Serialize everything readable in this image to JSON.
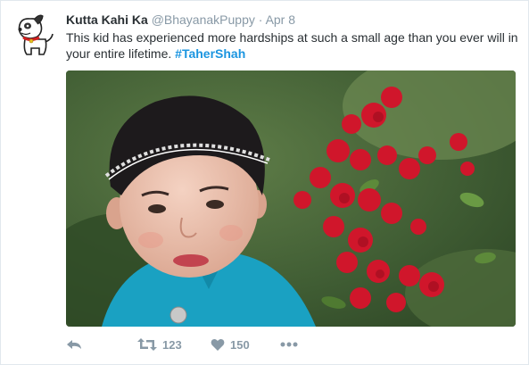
{
  "tweet": {
    "display_name": "Kutta Kahi Ka",
    "handle": "@BhayanakPuppy",
    "separator": "·",
    "timestamp": "Apr 8",
    "text": "This kid has experienced more hardships at such a small age than you ever will in your entire lifetime. ",
    "hashtag": "#TaherShah",
    "avatar_icon": "cartoon-dog-icon",
    "media_description_icon": "photo",
    "actions": {
      "reply_icon": "reply-icon",
      "retweet_icon": "retweet-icon",
      "retweet_count": "123",
      "like_icon": "heart-icon",
      "like_count": "150",
      "more_icon": "more-icon"
    }
  },
  "colors": {
    "name": "#292f33",
    "muted": "#8899a6",
    "hashtag": "#1b95e0",
    "border": "#e1e8ed"
  }
}
